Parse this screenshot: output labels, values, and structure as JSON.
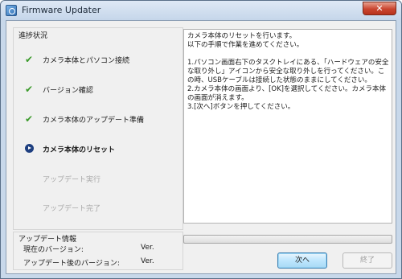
{
  "window": {
    "title": "Firmware Updater",
    "close_label": "✕"
  },
  "progress": {
    "group_label": "進捗状況",
    "steps": [
      {
        "label": "カメラ本体とパソコン接続",
        "state": "done"
      },
      {
        "label": "バージョン確認",
        "state": "done"
      },
      {
        "label": "カメラ本体のアップデート準備",
        "state": "done"
      },
      {
        "label": "カメラ本体のリセット",
        "state": "current"
      },
      {
        "label": "アップデート実行",
        "state": "pending"
      },
      {
        "label": "アップデート完了",
        "state": "pending"
      }
    ],
    "check_glyph": "✔"
  },
  "update_info": {
    "title": "アップデート情報",
    "current_version_label": "現在のバージョン:",
    "current_version_value": "Ver.",
    "new_version_label": "アップデート後のバージョン:",
    "new_version_value": "Ver."
  },
  "instructions": {
    "lines": [
      "カメラ本体のリセットを行います。",
      "以下の手順で作業を進めてください。",
      "",
      "1.パソコン画面右下のタスクトレイにある、「ハードウェアの安全な取り外し」アイコンから安全な取り外しを行ってください。この時、USBケーブルは接続した状態のままにしてください。",
      "2.カメラ本体の画面より、[OK]を選択してください。カメラ本体の画面が消えます。",
      "3.[次へ]ボタンを押してください。"
    ]
  },
  "progress_bar": {
    "value": 0
  },
  "buttons": {
    "next_label": "次へ",
    "finish_label": "終了"
  },
  "colors": {
    "check": "#3a9a2a",
    "current": "#1e3f80",
    "pending_text": "#aaaaaa",
    "close_button": "#c9452f"
  }
}
